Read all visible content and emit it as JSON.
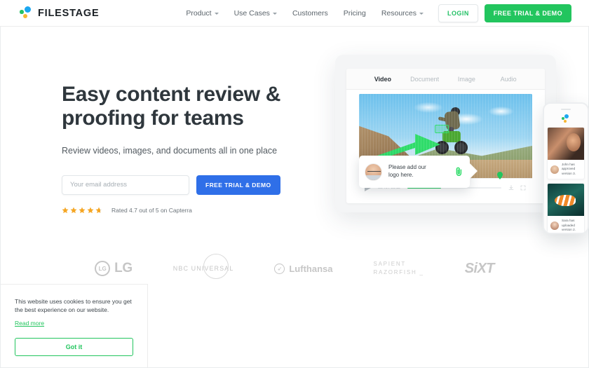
{
  "header": {
    "logo_text": "FILESTAGE",
    "nav": [
      {
        "label": "Product",
        "has_caret": true
      },
      {
        "label": "Use Cases",
        "has_caret": true
      },
      {
        "label": "Customers",
        "has_caret": false
      },
      {
        "label": "Pricing",
        "has_caret": false
      },
      {
        "label": "Resources",
        "has_caret": true
      }
    ],
    "login_label": "LOGIN",
    "trial_label": "FREE TRIAL & DEMO",
    "accent_green": "#22c55e"
  },
  "hero": {
    "title_line1": "Easy content review &",
    "title_line2": "proofing for teams",
    "subtitle": "Review videos, images, and documents all in one place",
    "email_placeholder": "Your email address",
    "email_value": "",
    "cta_label": "FREE TRIAL & DEMO",
    "cta_color": "#2f6fe8",
    "rating_text": "Rated 4.7 out of 5 on Capterra",
    "rating_value": 4.7,
    "rating_max": 5,
    "star_color": "#f5a623"
  },
  "mockup": {
    "tabs": [
      {
        "label": "Video",
        "active": true
      },
      {
        "label": "Document",
        "active": false
      },
      {
        "label": "Image",
        "active": false
      },
      {
        "label": "Audio",
        "active": false
      }
    ],
    "comment": {
      "line1": "Please add our",
      "line2": "logo here.",
      "attachment_icon": "paperclip-icon"
    },
    "player": {
      "current_time": "00:40",
      "total_time": "01:12",
      "time_display": "00:40 / 01:12",
      "play_icon": "play-icon",
      "download_icon": "download-icon",
      "fullscreen_icon": "fullscreen-icon",
      "marker_color": "#22c55e"
    },
    "phone": {
      "notifications": [
        {
          "text_line1": "John has approved",
          "text_line2": "version 3."
        },
        {
          "text_line1": "Sara has uploaded",
          "text_line2": "version 2."
        }
      ]
    }
  },
  "logos": {
    "lg": {
      "mark": "LG",
      "text": "LG"
    },
    "nbc": {
      "text": "NBC  UNIVERSAL"
    },
    "lufthansa": {
      "text": "Lufthansa"
    },
    "sapient": {
      "line1": "SAPIENT",
      "line2": "RAZORFISH _"
    },
    "sixt": {
      "text": "SiXT"
    }
  },
  "cookie": {
    "text_line1": "This website uses cookies to ensure you get",
    "text_line2": "the best experience on our website.",
    "link_label": "Read more",
    "button_label": "Got it"
  }
}
